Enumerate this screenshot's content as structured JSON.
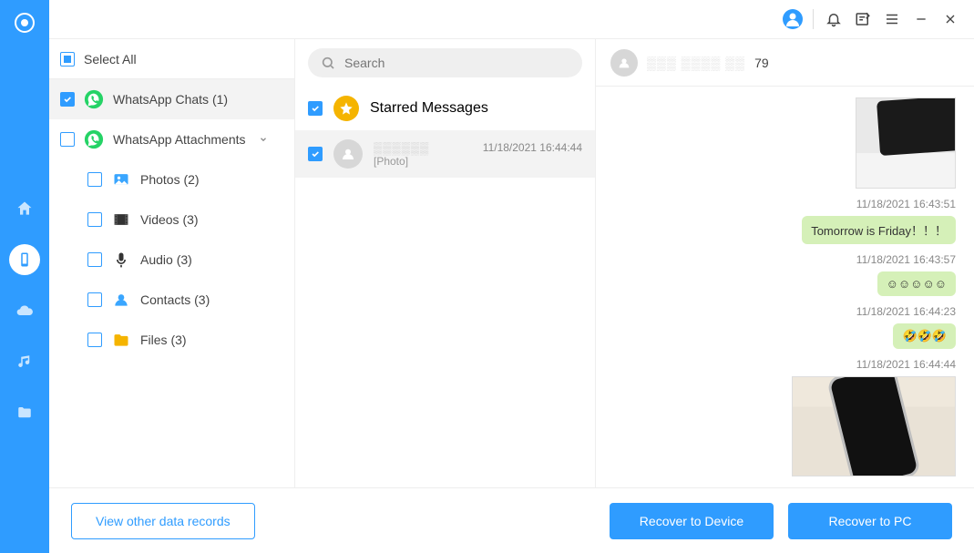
{
  "topbar": {
    "icons": [
      "avatar",
      "bell",
      "edit",
      "menu",
      "minimize",
      "close"
    ]
  },
  "rail": {
    "items": [
      "logo",
      "home",
      "device",
      "cloud",
      "music",
      "folder"
    ],
    "active_index": 2
  },
  "tree": {
    "select_all_label": "Select All",
    "categories": [
      {
        "label": "WhatsApp Chats (1)",
        "icon": "whatsapp",
        "checked": true,
        "active": true
      },
      {
        "label": "WhatsApp Attachments",
        "icon": "whatsapp",
        "checked": false,
        "expandable": true,
        "children": [
          {
            "label": "Photos (2)",
            "icon": "photos"
          },
          {
            "label": "Videos (3)",
            "icon": "videos"
          },
          {
            "label": "Audio (3)",
            "icon": "audio"
          },
          {
            "label": "Contacts (3)",
            "icon": "contacts"
          },
          {
            "label": "Files (3)",
            "icon": "files"
          }
        ]
      }
    ]
  },
  "chatlist": {
    "search_placeholder": "Search",
    "starred_label": "Starred Messages",
    "items": [
      {
        "name_masked": "",
        "subtitle": "[Photo]",
        "timestamp": "11/18/2021 16:44:44",
        "checked": true,
        "selected": true
      }
    ]
  },
  "conversation": {
    "header_suffix": "79",
    "messages": [
      {
        "type": "image",
        "variant": "keyboard"
      },
      {
        "type": "timestamp",
        "text": "11/18/2021 16:43:51"
      },
      {
        "type": "text",
        "text": "Tomorrow is Friday！！！"
      },
      {
        "type": "timestamp",
        "text": "11/18/2021 16:43:57"
      },
      {
        "type": "emoji",
        "text": "☺☺☺☺☺"
      },
      {
        "type": "timestamp",
        "text": "11/18/2021 16:44:23"
      },
      {
        "type": "emoji",
        "text": "🤣🤣🤣"
      },
      {
        "type": "timestamp",
        "text": "11/18/2021 16:44:44"
      },
      {
        "type": "image",
        "variant": "phone"
      }
    ]
  },
  "footer": {
    "view_other": "View other data records",
    "recover_device": "Recover to Device",
    "recover_pc": "Recover to PC"
  }
}
